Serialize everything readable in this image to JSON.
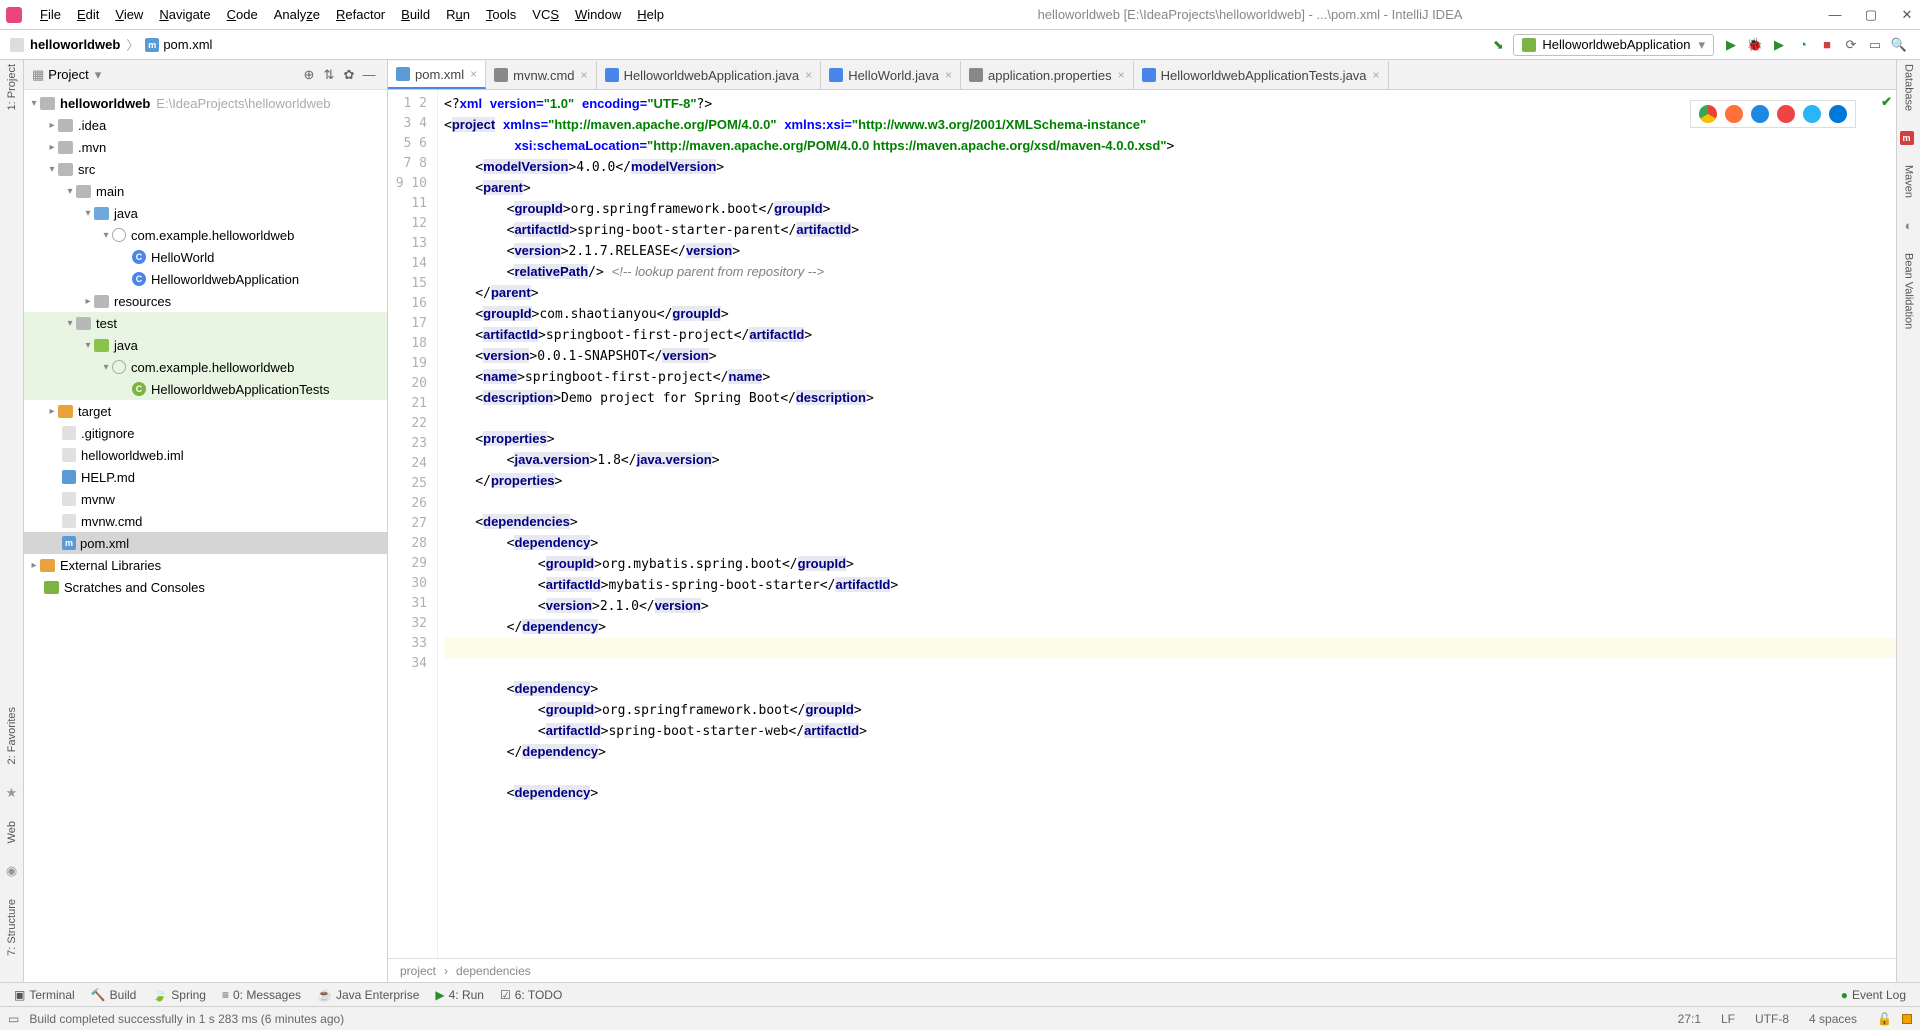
{
  "window": {
    "title": "helloworldweb [E:\\IdeaProjects\\helloworldweb] - ...\\pom.xml - IntelliJ IDEA"
  },
  "menu": [
    "File",
    "Edit",
    "View",
    "Navigate",
    "Code",
    "Analyze",
    "Refactor",
    "Build",
    "Run",
    "Tools",
    "VCS",
    "Window",
    "Help"
  ],
  "breadcrumb": {
    "project": "helloworldweb",
    "file": "pom.xml"
  },
  "runConfig": "HelloworldwebApplication",
  "projectPanel": {
    "title": "Project"
  },
  "tree": {
    "root": {
      "name": "helloworldweb",
      "path": "E:\\IdeaProjects\\helloworldweb"
    },
    "idea": ".idea",
    "mvn": ".mvn",
    "src": "src",
    "main": "main",
    "java1": "java",
    "pkg1": "com.example.helloworldweb",
    "cls1": "HelloWorld",
    "cls2": "HelloworldwebApplication",
    "resources": "resources",
    "test": "test",
    "java2": "java",
    "pkg2": "com.example.helloworldweb",
    "cls3": "HelloworldwebApplicationTests",
    "target": "target",
    "gitignore": ".gitignore",
    "iml": "helloworldweb.iml",
    "help": "HELP.md",
    "mvnw": "mvnw",
    "mvnwcmd": "mvnw.cmd",
    "pom": "pom.xml",
    "extlib": "External Libraries",
    "scratch": "Scratches and Consoles"
  },
  "tabs": [
    {
      "label": "pom.xml",
      "active": true,
      "ico": "#5b9bd5"
    },
    {
      "label": "mvnw.cmd",
      "active": false,
      "ico": "#888"
    },
    {
      "label": "HelloworldwebApplication.java",
      "active": false,
      "ico": "#4a86e8"
    },
    {
      "label": "HelloWorld.java",
      "active": false,
      "ico": "#4a86e8"
    },
    {
      "label": "application.properties",
      "active": false,
      "ico": "#888"
    },
    {
      "label": "HelloworldwebApplicationTests.java",
      "active": false,
      "ico": "#4a86e8"
    }
  ],
  "crumbs": {
    "a": "project",
    "b": "dependencies"
  },
  "bottomTools": {
    "terminal": "Terminal",
    "build": "Build",
    "spring": "Spring",
    "messages": "0: Messages",
    "javaee": "Java Enterprise",
    "run": "4: Run",
    "todo": "6: TODO",
    "eventlog": "Event Log"
  },
  "status": {
    "msg": "Build completed successfully in 1 s 283 ms (6 minutes ago)",
    "pos": "27:1",
    "lf": "LF",
    "enc": "UTF-8",
    "indent": "4 spaces"
  },
  "rightRail": {
    "db": "Database",
    "mvn": "Maven",
    "bv": "Bean Validation"
  },
  "leftRail": {
    "proj": "1: Project",
    "fav": "2: Favorites",
    "struct": "7: Structure",
    "web": "Web"
  },
  "lineStart": 1,
  "lineEnd": 34
}
